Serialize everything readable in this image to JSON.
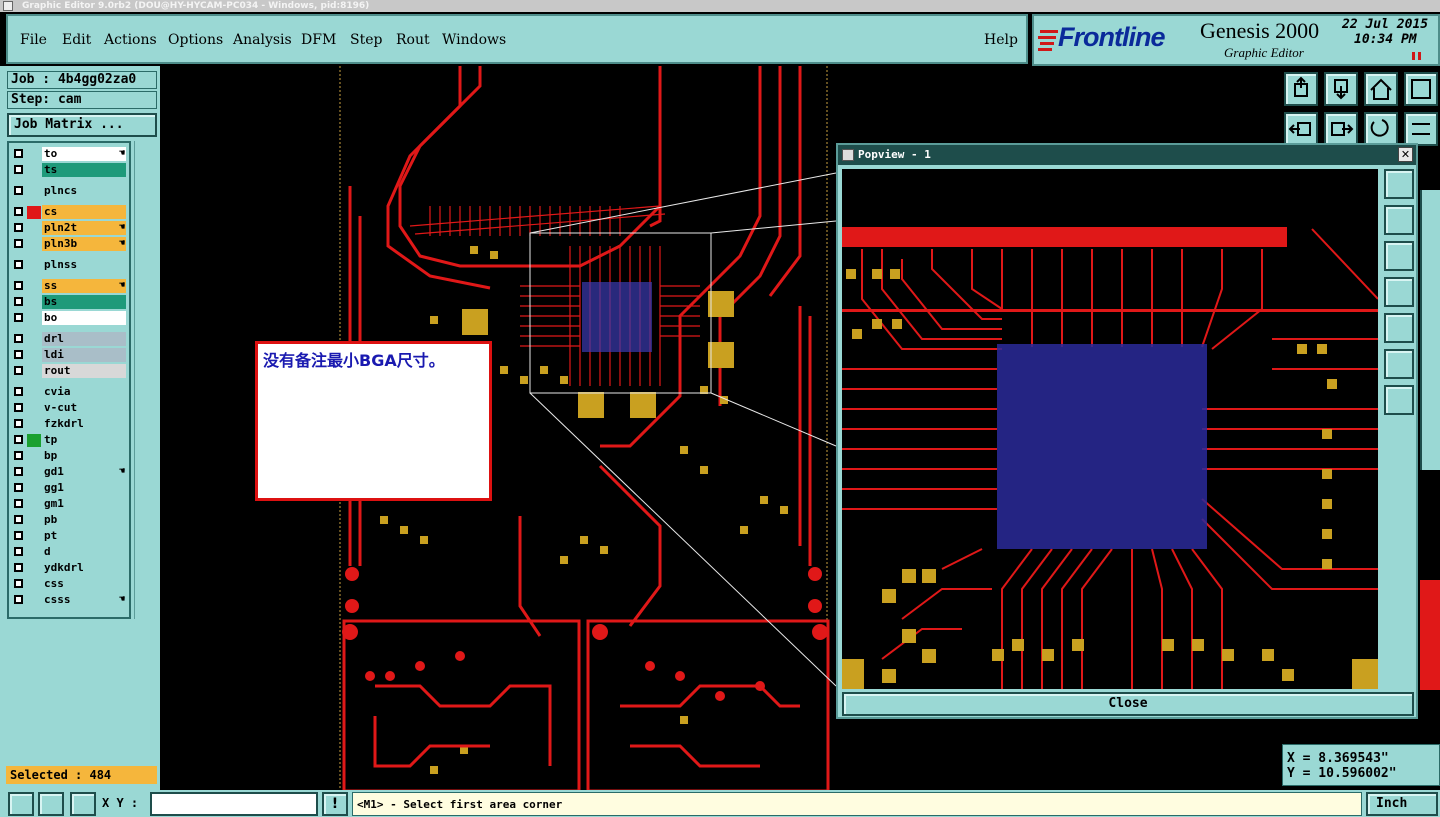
{
  "window": {
    "title": "Graphic Editor 9.0rb2 (DOU@HY-HYCAM-PC034 - Windows, pid:8196)"
  },
  "menu": [
    "File",
    "Edit",
    "Actions",
    "Options",
    "Analysis",
    "DFM",
    "Step",
    "Rout",
    "Windows"
  ],
  "help": "Help",
  "brand": {
    "logo": "Frontline",
    "product": "Genesis 2000",
    "subtitle": "Graphic Editor",
    "date": "22 Jul 2015",
    "time": "10:34 PM"
  },
  "job": {
    "job": "Job : 4b4gg02za0",
    "step": "Step: cam",
    "matrix_button": "Job Matrix ..."
  },
  "layers": [
    {
      "name": "to",
      "color": "#ffffff",
      "marker": "",
      "hand": true
    },
    {
      "name": "ts",
      "color": "#1e9a7a",
      "marker": "",
      "hand": false
    },
    {
      "name": "plncs",
      "color": "#9ad8d4",
      "marker": "",
      "hand": false
    },
    {
      "name": "cs",
      "color": "#f5b63c",
      "marker": "#e01818",
      "hand": false
    },
    {
      "name": "pln2t",
      "color": "#f5b63c",
      "marker": "",
      "hand": true
    },
    {
      "name": "pln3b",
      "color": "#f5b63c",
      "marker": "",
      "hand": true
    },
    {
      "name": "plnss",
      "color": "#9ad8d4",
      "marker": "",
      "hand": false
    },
    {
      "name": "ss",
      "color": "#f5b63c",
      "marker": "",
      "hand": true
    },
    {
      "name": "bs",
      "color": "#1e9a7a",
      "marker": "",
      "hand": false
    },
    {
      "name": "bo",
      "color": "#ffffff",
      "marker": "",
      "hand": false
    },
    {
      "name": "drl",
      "color": "#a9bec8",
      "marker": "",
      "hand": false
    },
    {
      "name": "ldi",
      "color": "#a9bec8",
      "marker": "",
      "hand": false
    },
    {
      "name": "rout",
      "color": "#d8d8d8",
      "marker": "",
      "hand": false
    },
    {
      "name": "cvia",
      "color": "#9ad8d4",
      "marker": "",
      "hand": false
    },
    {
      "name": "v-cut",
      "color": "#9ad8d4",
      "marker": "",
      "hand": false
    },
    {
      "name": "fzkdrl",
      "color": "#9ad8d4",
      "marker": "",
      "hand": false
    },
    {
      "name": "tp",
      "color": "#9ad8d4",
      "marker": "#1aa030",
      "hand": false
    },
    {
      "name": "bp",
      "color": "#9ad8d4",
      "marker": "",
      "hand": false
    },
    {
      "name": "gd1",
      "color": "#9ad8d4",
      "marker": "",
      "hand": true
    },
    {
      "name": "gg1",
      "color": "#9ad8d4",
      "marker": "",
      "hand": false
    },
    {
      "name": "gm1",
      "color": "#9ad8d4",
      "marker": "",
      "hand": false
    },
    {
      "name": "pb",
      "color": "#9ad8d4",
      "marker": "",
      "hand": false
    },
    {
      "name": "pt",
      "color": "#9ad8d4",
      "marker": "",
      "hand": false
    },
    {
      "name": "d",
      "color": "#9ad8d4",
      "marker": "",
      "hand": false
    },
    {
      "name": "ydkdrl",
      "color": "#9ad8d4",
      "marker": "",
      "hand": false
    },
    {
      "name": "css",
      "color": "#9ad8d4",
      "marker": "",
      "hand": false
    },
    {
      "name": "csss",
      "color": "#9ad8d4",
      "marker": "",
      "hand": true
    }
  ],
  "selected": "Selected : 484",
  "note": {
    "text": "没有备注最小BGA尺寸。"
  },
  "popview": {
    "title": "Popview - 1",
    "close": "Close"
  },
  "coords": {
    "x": "X =  8.369543\"",
    "y": "Y = 10.596002\""
  },
  "status": {
    "xy_label": "X Y :",
    "prompt": "<M1> - Select first area corner",
    "units": "Inch"
  }
}
